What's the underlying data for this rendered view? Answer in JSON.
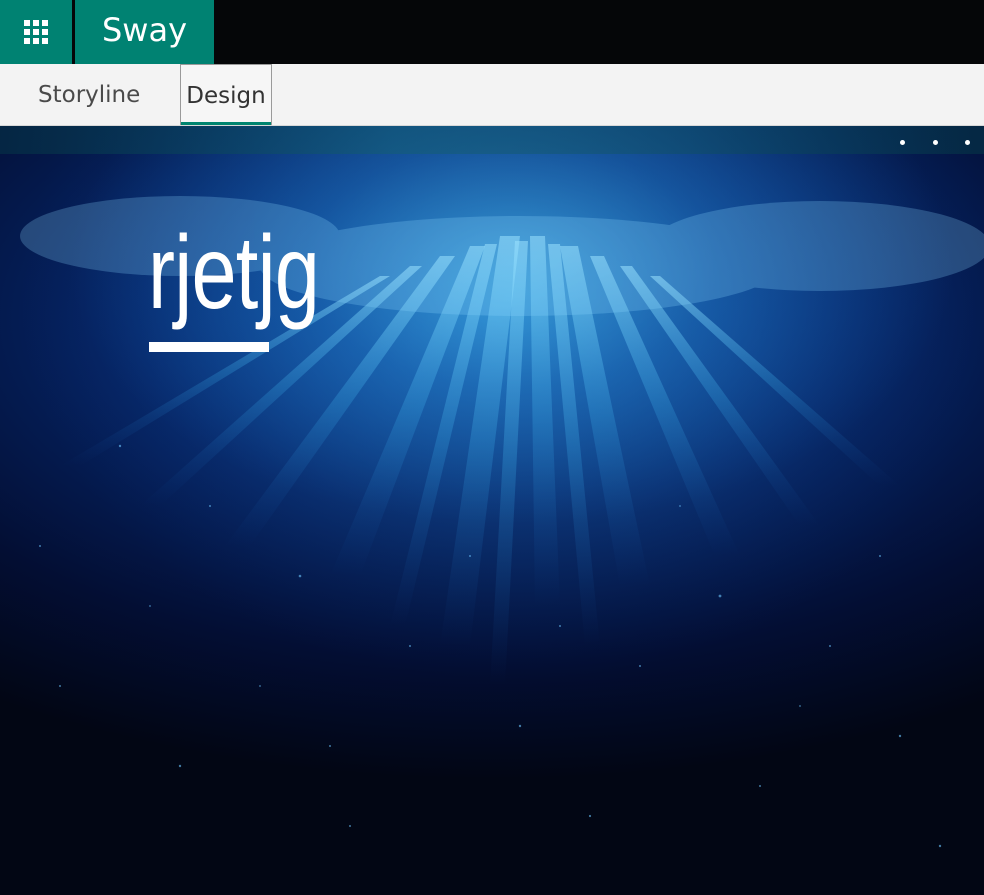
{
  "app": {
    "brand": "Sway"
  },
  "tabs": [
    {
      "label": "Storyline",
      "selected": false
    },
    {
      "label": "Design",
      "selected": true
    }
  ],
  "sway": {
    "title": "rjetjg"
  },
  "colors": {
    "brand": "#008272",
    "tab_accent": "#00846f",
    "topbar": "#050608",
    "tabbar": "#f3f3f3"
  },
  "icons": {
    "app_launcher": "waffle-icon",
    "more": "more-dots-icon"
  }
}
